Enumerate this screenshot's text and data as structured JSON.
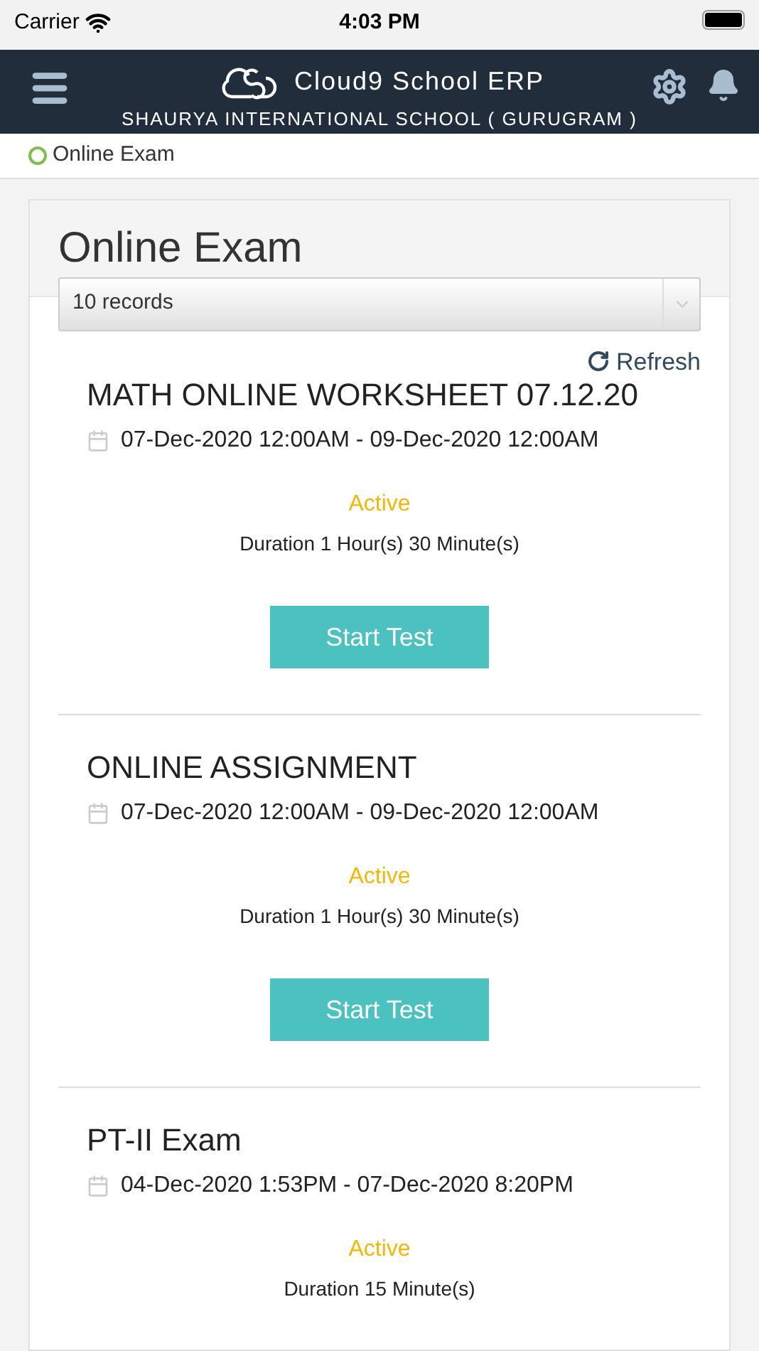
{
  "status_bar": {
    "carrier": "Carrier",
    "time": "4:03 PM"
  },
  "header": {
    "app_name": "Cloud9 School ERP",
    "school": "SHAURYA INTERNATIONAL SCHOOL ( GURUGRAM )"
  },
  "breadcrumb": "Online Exam",
  "panel": {
    "title": "Online Exam",
    "records_select": "10 records",
    "refresh": "Refresh"
  },
  "exams": [
    {
      "title": "MATH ONLINE WORKSHEET 07.12.20",
      "dates": "07-Dec-2020 12:00AM - 09-Dec-2020 12:00AM",
      "status": "Active",
      "color": "#f5b800",
      "duration": "Duration 1 Hour(s) 30 Minute(s)",
      "button": "Start Test"
    },
    {
      "title": "ONLINE ASSIGNMENT",
      "dates": "07-Dec-2020 12:00AM - 09-Dec-2020 12:00AM",
      "status": "Active",
      "color": "#f5b800",
      "duration": "Duration 1 Hour(s) 30 Minute(s)",
      "button": "Start Test"
    },
    {
      "title": "PT-II Exam",
      "dates": "04-Dec-2020 1:53PM - 07-Dec-2020 8:20PM",
      "status": "Active",
      "color": "#f5b800",
      "duration": "Duration 15 Minute(s)"
    }
  ]
}
